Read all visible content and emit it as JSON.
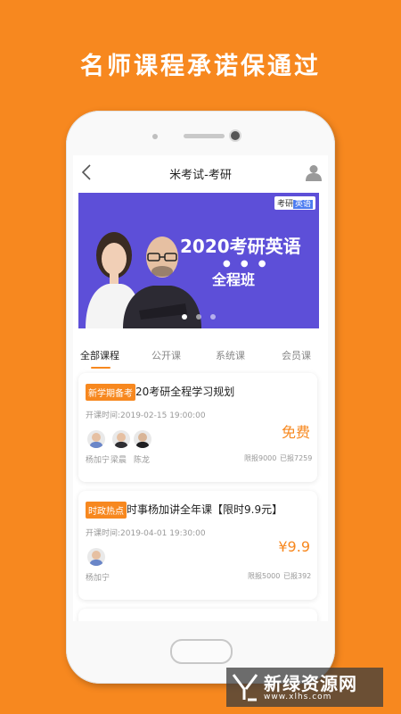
{
  "headline": "名师课程承诺保通过",
  "nav": {
    "title": "米考试-考研"
  },
  "banner": {
    "tag_a": "考研",
    "tag_b": "英语",
    "title": "2020考研英语",
    "dots": "● ● ●",
    "subtitle": "全程班"
  },
  "tabs": [
    "全部课程",
    "公开课",
    "系统课",
    "会员课"
  ],
  "courses": [
    {
      "badge": "新学期备考",
      "title": "20考研全程学习规划",
      "time": "开课时间:2019-02-15 19:00:00",
      "price": "免费",
      "teachers": [
        "杨加宁",
        "梁晨",
        "陈龙"
      ],
      "limit": "限报9000",
      "enrolled": "已报7259"
    },
    {
      "badge": "时政热点",
      "title": "时事杨加讲全年课【限时9.9元】",
      "time": "开课时间:2019-04-01 19:30:00",
      "price": "¥9.9",
      "teachers": [
        "杨加宁"
      ],
      "limit": "限报5000",
      "enrolled": "已报392"
    }
  ],
  "watermark": {
    "name": "新绿资源网",
    "url": "www.xlhs.com"
  },
  "colors": {
    "accent": "#f7881f",
    "banner": "#5d4fd8"
  }
}
